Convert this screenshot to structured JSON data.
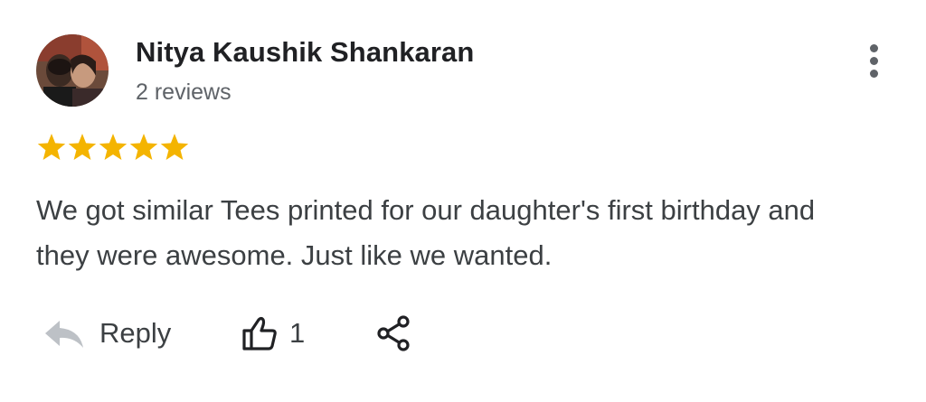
{
  "review": {
    "author": {
      "name": "Nitya Kaushik Shankaran",
      "reviews_count": "2 reviews",
      "avatar": "profile-photo"
    },
    "rating": 5,
    "rating_max": 5,
    "text": "We got similar Tees printed for our daughter's first birthday and they were awesome. Just like we wanted.",
    "actions": {
      "reply_label": "Reply",
      "reply_icon": "reply-arrow-icon",
      "like_icon": "thumb-up-icon",
      "like_count": "1",
      "share_icon": "share-icon",
      "more_icon": "more-vert-icon"
    }
  },
  "colors": {
    "star": "#F4B400",
    "name_text": "#202124",
    "secondary_text": "#5F6368",
    "body_text": "#3C4043",
    "reply_icon": "#BDC1C6",
    "icon": "#202124"
  }
}
